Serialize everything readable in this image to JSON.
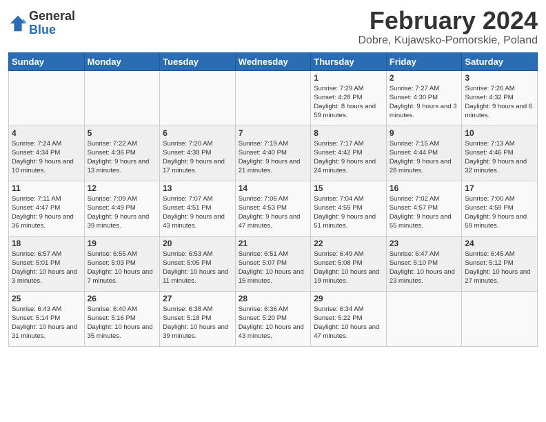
{
  "logo": {
    "general": "General",
    "blue": "Blue"
  },
  "header": {
    "title": "February 2024",
    "location": "Dobre, Kujawsko-Pomorskie, Poland"
  },
  "days_of_week": [
    "Sunday",
    "Monday",
    "Tuesday",
    "Wednesday",
    "Thursday",
    "Friday",
    "Saturday"
  ],
  "weeks": [
    [
      {
        "day": "",
        "info": ""
      },
      {
        "day": "",
        "info": ""
      },
      {
        "day": "",
        "info": ""
      },
      {
        "day": "",
        "info": ""
      },
      {
        "day": "1",
        "info": "Sunrise: 7:29 AM\nSunset: 4:28 PM\nDaylight: 8 hours and 59 minutes."
      },
      {
        "day": "2",
        "info": "Sunrise: 7:27 AM\nSunset: 4:30 PM\nDaylight: 9 hours and 3 minutes."
      },
      {
        "day": "3",
        "info": "Sunrise: 7:26 AM\nSunset: 4:32 PM\nDaylight: 9 hours and 6 minutes."
      }
    ],
    [
      {
        "day": "4",
        "info": "Sunrise: 7:24 AM\nSunset: 4:34 PM\nDaylight: 9 hours and 10 minutes."
      },
      {
        "day": "5",
        "info": "Sunrise: 7:22 AM\nSunset: 4:36 PM\nDaylight: 9 hours and 13 minutes."
      },
      {
        "day": "6",
        "info": "Sunrise: 7:20 AM\nSunset: 4:38 PM\nDaylight: 9 hours and 17 minutes."
      },
      {
        "day": "7",
        "info": "Sunrise: 7:19 AM\nSunset: 4:40 PM\nDaylight: 9 hours and 21 minutes."
      },
      {
        "day": "8",
        "info": "Sunrise: 7:17 AM\nSunset: 4:42 PM\nDaylight: 9 hours and 24 minutes."
      },
      {
        "day": "9",
        "info": "Sunrise: 7:15 AM\nSunset: 4:44 PM\nDaylight: 9 hours and 28 minutes."
      },
      {
        "day": "10",
        "info": "Sunrise: 7:13 AM\nSunset: 4:46 PM\nDaylight: 9 hours and 32 minutes."
      }
    ],
    [
      {
        "day": "11",
        "info": "Sunrise: 7:11 AM\nSunset: 4:47 PM\nDaylight: 9 hours and 36 minutes."
      },
      {
        "day": "12",
        "info": "Sunrise: 7:09 AM\nSunset: 4:49 PM\nDaylight: 9 hours and 39 minutes."
      },
      {
        "day": "13",
        "info": "Sunrise: 7:07 AM\nSunset: 4:51 PM\nDaylight: 9 hours and 43 minutes."
      },
      {
        "day": "14",
        "info": "Sunrise: 7:06 AM\nSunset: 4:53 PM\nDaylight: 9 hours and 47 minutes."
      },
      {
        "day": "15",
        "info": "Sunrise: 7:04 AM\nSunset: 4:55 PM\nDaylight: 9 hours and 51 minutes."
      },
      {
        "day": "16",
        "info": "Sunrise: 7:02 AM\nSunset: 4:57 PM\nDaylight: 9 hours and 55 minutes."
      },
      {
        "day": "17",
        "info": "Sunrise: 7:00 AM\nSunset: 4:59 PM\nDaylight: 9 hours and 59 minutes."
      }
    ],
    [
      {
        "day": "18",
        "info": "Sunrise: 6:57 AM\nSunset: 5:01 PM\nDaylight: 10 hours and 3 minutes."
      },
      {
        "day": "19",
        "info": "Sunrise: 6:55 AM\nSunset: 5:03 PM\nDaylight: 10 hours and 7 minutes."
      },
      {
        "day": "20",
        "info": "Sunrise: 6:53 AM\nSunset: 5:05 PM\nDaylight: 10 hours and 11 minutes."
      },
      {
        "day": "21",
        "info": "Sunrise: 6:51 AM\nSunset: 5:07 PM\nDaylight: 10 hours and 15 minutes."
      },
      {
        "day": "22",
        "info": "Sunrise: 6:49 AM\nSunset: 5:08 PM\nDaylight: 10 hours and 19 minutes."
      },
      {
        "day": "23",
        "info": "Sunrise: 6:47 AM\nSunset: 5:10 PM\nDaylight: 10 hours and 23 minutes."
      },
      {
        "day": "24",
        "info": "Sunrise: 6:45 AM\nSunset: 5:12 PM\nDaylight: 10 hours and 27 minutes."
      }
    ],
    [
      {
        "day": "25",
        "info": "Sunrise: 6:43 AM\nSunset: 5:14 PM\nDaylight: 10 hours and 31 minutes."
      },
      {
        "day": "26",
        "info": "Sunrise: 6:40 AM\nSunset: 5:16 PM\nDaylight: 10 hours and 35 minutes."
      },
      {
        "day": "27",
        "info": "Sunrise: 6:38 AM\nSunset: 5:18 PM\nDaylight: 10 hours and 39 minutes."
      },
      {
        "day": "28",
        "info": "Sunrise: 6:36 AM\nSunset: 5:20 PM\nDaylight: 10 hours and 43 minutes."
      },
      {
        "day": "29",
        "info": "Sunrise: 6:34 AM\nSunset: 5:22 PM\nDaylight: 10 hours and 47 minutes."
      },
      {
        "day": "",
        "info": ""
      },
      {
        "day": "",
        "info": ""
      }
    ]
  ]
}
